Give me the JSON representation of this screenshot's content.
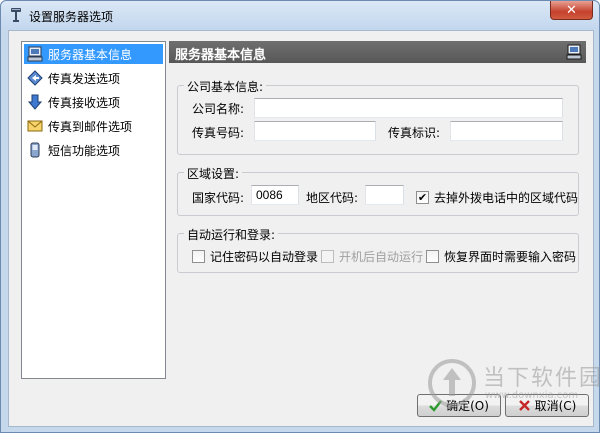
{
  "window": {
    "title": "设置服务器选项",
    "close_label": "✕"
  },
  "nav": {
    "items": [
      {
        "label": "服务器基本信息",
        "icon": "server-icon",
        "selected": true
      },
      {
        "label": "传真发送选项",
        "icon": "fax-send-icon",
        "selected": false
      },
      {
        "label": "传真接收选项",
        "icon": "fax-receive-icon",
        "selected": false
      },
      {
        "label": "传真到邮件选项",
        "icon": "envelope-icon",
        "selected": false
      },
      {
        "label": "短信功能选项",
        "icon": "mobile-phone-icon",
        "selected": false
      }
    ]
  },
  "panel": {
    "title": "服务器基本信息",
    "company": {
      "legend": "公司基本信息:",
      "name_label": "公司名称:",
      "name_value": "",
      "fax_number_label": "传真号码:",
      "fax_number_value": "",
      "fax_id_label": "传真标识:",
      "fax_id_value": ""
    },
    "region": {
      "legend": "区域设置:",
      "country_code_label": "国家代码:",
      "country_code_value": "0086",
      "area_code_label": "地区代码:",
      "area_code_value": "",
      "strip_area_code_label": "去掉外拨电话中的区域代码",
      "strip_area_code_checked": true
    },
    "autorun": {
      "legend": "自动运行和登录:",
      "remember_password_label": "记住密码以自动登录",
      "remember_password_checked": false,
      "auto_start_label": "开机后自动运行",
      "auto_start_checked": false,
      "auto_start_enabled": false,
      "restore_password_label": "恢复界面时需要输入密码",
      "restore_password_checked": false
    }
  },
  "buttons": {
    "ok_label": "确定(O)",
    "cancel_label": "取消(C)"
  },
  "watermark": {
    "text": "当下软件园",
    "url": "www.downxia.com"
  },
  "colors": {
    "selection": "#3399ff",
    "panel_header": "#626262",
    "ok_check": "#2c9a2c",
    "cancel_x": "#c62828"
  }
}
